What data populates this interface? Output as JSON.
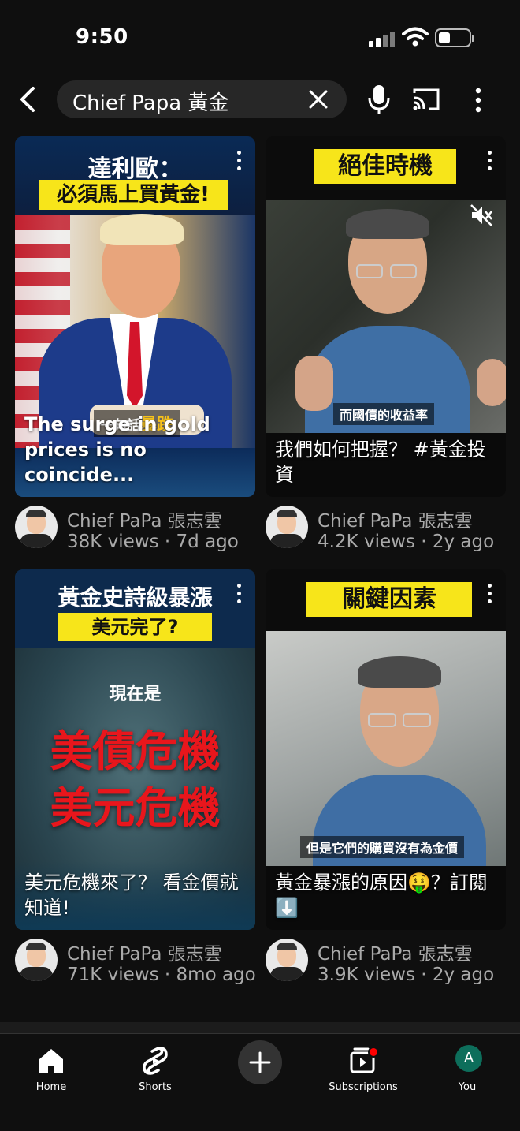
{
  "status_bar": {
    "time": "9:50"
  },
  "search": {
    "query": "Chief Papa 黃金"
  },
  "videos": [
    {
      "thumb_title": "達利歐：",
      "thumb_banner": "必須馬上買黃金!",
      "thumb_subtitle_prefix": "一句話",
      "thumb_subtitle_highlight": "暴跌",
      "caption": "The surge in gold prices is no coincide...",
      "channel": "Chief PaPa 張志雲",
      "meta": "38K views · 7d ago"
    },
    {
      "thumb_banner": "絕佳時機",
      "thumb_subtitle": "而國債的收益率",
      "caption": "我們如何把握？ #黃金投資",
      "channel": "Chief PaPa 張志雲",
      "meta": "4.2K views · 2y ago"
    },
    {
      "thumb_title": "黃金史詩級暴漲",
      "thumb_banner": "美元完了?",
      "thumb_line1": "現在是",
      "thumb_line2": "美債危機",
      "thumb_line3": "美元危機",
      "caption": "美元危機來了？ 看金價就知道!",
      "channel": "Chief PaPa 張志雲",
      "meta": "71K views · 8mo ago"
    },
    {
      "thumb_banner": "關鍵因素",
      "thumb_subtitle": "但是它們的購買沒有為金價",
      "caption": "黃金暴漲的原因🤑？訂閱 ⬇️",
      "channel": "Chief PaPa 張志雲",
      "meta": "3.9K views · 2y ago"
    }
  ],
  "nav": {
    "home": "Home",
    "shorts": "Shorts",
    "subscriptions": "Subscriptions",
    "you": "You",
    "you_initial": "A"
  },
  "colors": {
    "background": "#0f0f0f",
    "accent_red": "#ff0000",
    "banner_yellow": "#f7e51a"
  }
}
